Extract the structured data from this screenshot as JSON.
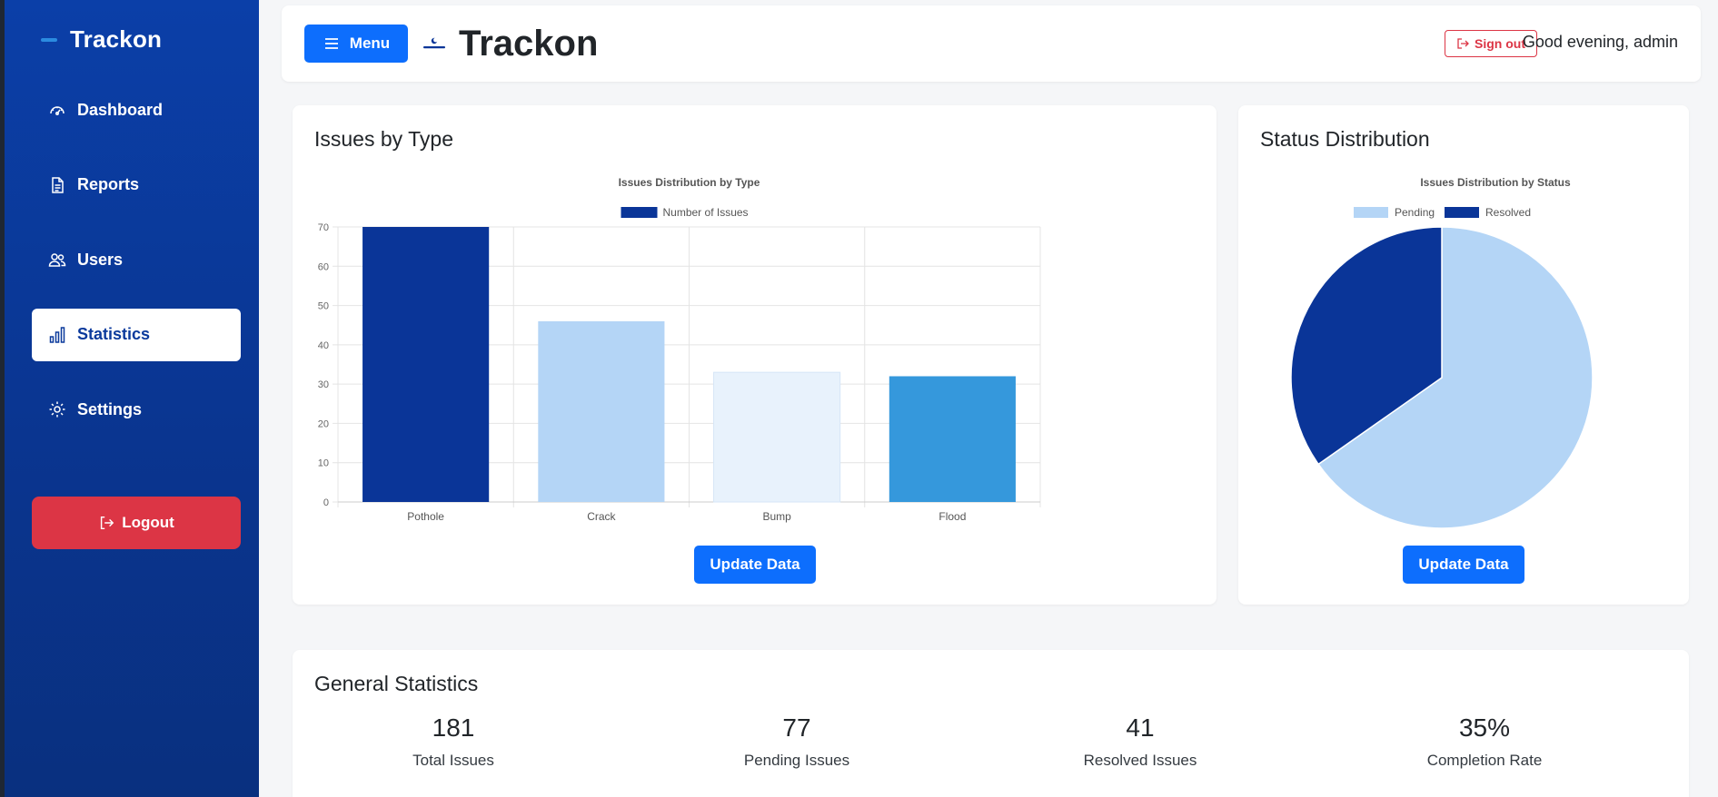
{
  "sidebar": {
    "brand": "Trackon",
    "items": [
      {
        "label": "Dashboard",
        "icon": "gauge-icon",
        "active": false
      },
      {
        "label": "Reports",
        "icon": "document-icon",
        "active": false
      },
      {
        "label": "Users",
        "icon": "users-icon",
        "active": false
      },
      {
        "label": "Statistics",
        "icon": "bar-chart-icon",
        "active": true
      },
      {
        "label": "Settings",
        "icon": "gear-icon",
        "active": false
      }
    ],
    "logout_label": "Logout"
  },
  "header": {
    "menu_label": "Menu",
    "title": "Trackon",
    "signout_label": "Sign out",
    "greeting": "Good evening, admin"
  },
  "type_card": {
    "title": "Issues by Type",
    "update_label": "Update Data"
  },
  "status_card": {
    "title": "Status Distribution",
    "update_label": "Update Data"
  },
  "stats": {
    "title": "General Statistics",
    "items": [
      {
        "value": "181",
        "label": "Total Issues"
      },
      {
        "value": "77",
        "label": "Pending Issues"
      },
      {
        "value": "41",
        "label": "Resolved Issues"
      },
      {
        "value": "35%",
        "label": "Completion Rate"
      }
    ]
  },
  "colors": {
    "sidebar": "#0b3fa8",
    "primary": "#0d6efd",
    "danger": "#dc3545",
    "dark_blue": "#0a3598",
    "light_blue": "#b4d5f6",
    "pale_blue": "#e8f2fc",
    "mid_blue": "#3598dc"
  },
  "chart_data": [
    {
      "type": "bar",
      "title": "Issues Distribution by Type",
      "categories": [
        "Pothole",
        "Crack",
        "Bump",
        "Flood"
      ],
      "series": [
        {
          "name": "Number of Issues",
          "values": [
            70,
            46,
            33,
            32
          ]
        }
      ],
      "bar_colors": [
        "#0a3598",
        "#b4d5f6",
        "#e8f2fc",
        "#3598dc"
      ],
      "ylim": [
        0,
        70
      ],
      "yticks": [
        0,
        10,
        20,
        30,
        40,
        50,
        60,
        70
      ],
      "grid": true,
      "legend": "top"
    },
    {
      "type": "pie",
      "title": "Issues Distribution by Status",
      "labels": [
        "Pending",
        "Resolved"
      ],
      "values": [
        77,
        41
      ],
      "colors": [
        "#b4d5f6",
        "#0a3598"
      ],
      "legend": "top"
    }
  ]
}
